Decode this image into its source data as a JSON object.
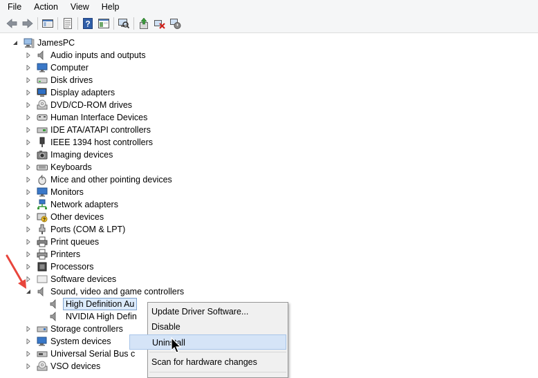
{
  "menu": [
    "File",
    "Action",
    "View",
    "Help"
  ],
  "toolbar": {
    "buttons": [
      "back-icon",
      "forward-icon",
      "show-hide-tree-icon",
      "properties-icon",
      "help-icon",
      "show-view-icon",
      "scan-hardware-icon",
      "update-driver-icon",
      "uninstall-icon",
      "enable-device-icon"
    ]
  },
  "tree": {
    "root": "JamesPC",
    "categories": [
      "Audio inputs and outputs",
      "Computer",
      "Disk drives",
      "Display adapters",
      "DVD/CD-ROM drives",
      "Human Interface Devices",
      "IDE ATA/ATAPI controllers",
      "IEEE 1394 host controllers",
      "Imaging devices",
      "Keyboards",
      "Mice and other pointing devices",
      "Monitors",
      "Network adapters",
      "Other devices",
      "Ports (COM & LPT)",
      "Print queues",
      "Printers",
      "Processors",
      "Software devices",
      "Sound, video and game controllers"
    ],
    "sound_children": [
      "High Definition Audio Device",
      "NVIDIA High Definition Audio"
    ],
    "sound_children_visible": [
      "High Definition Au",
      "NVIDIA High Defin"
    ],
    "after": [
      "Storage controllers",
      "System devices",
      "Universal Serial Bus c",
      "VSO devices"
    ]
  },
  "context_menu": {
    "items": [
      "Update Driver Software...",
      "Disable",
      "Uninstall",
      "Scan for hardware changes"
    ],
    "highlighted": "Uninstall"
  },
  "colors": {
    "selection_bg": "#dcebfc",
    "menu_highlight": "#d5e4f7",
    "arrow": "#e8453c"
  }
}
